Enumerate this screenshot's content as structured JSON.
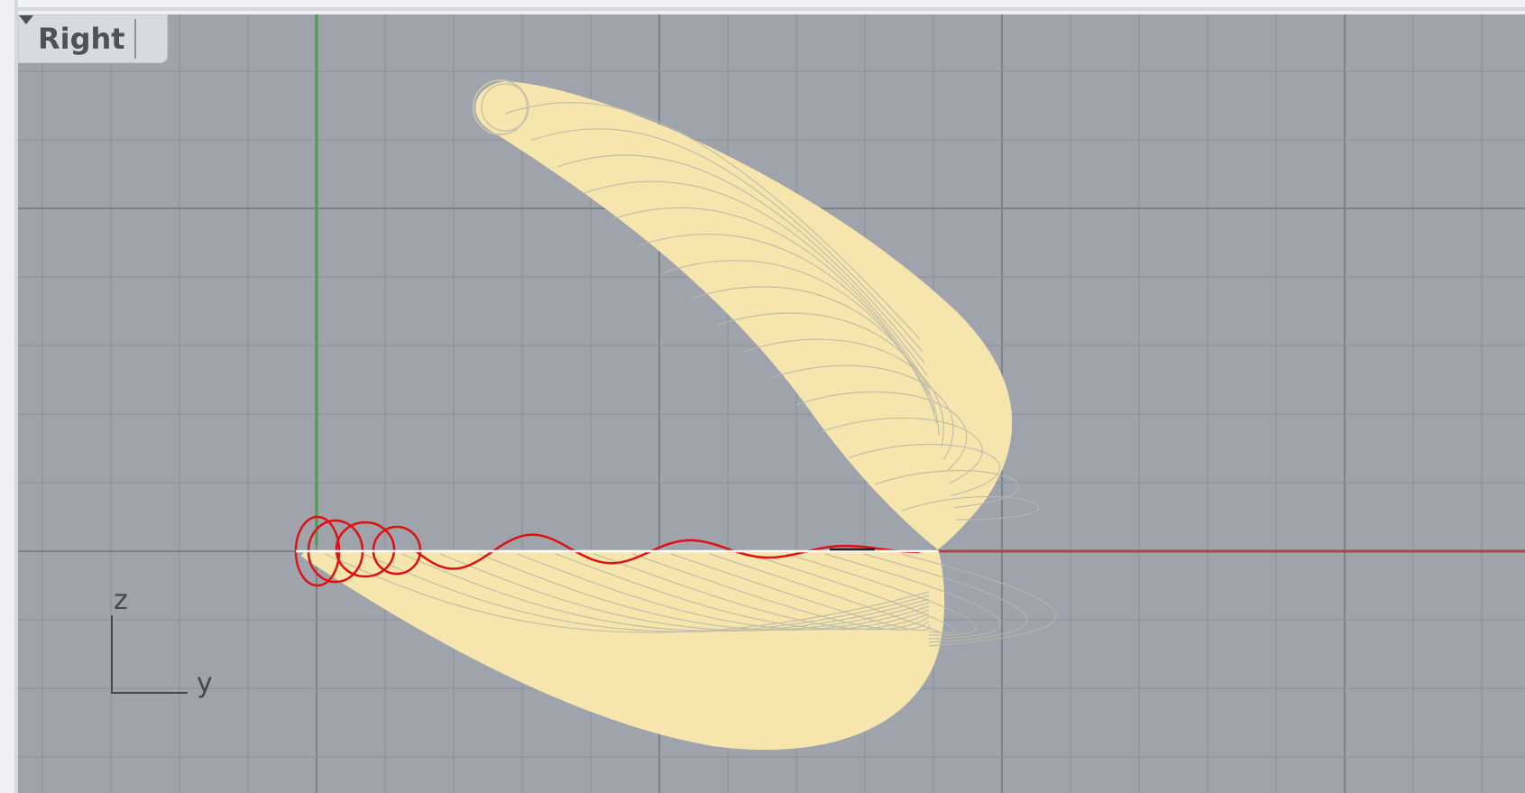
{
  "viewport": {
    "name": "Right",
    "dropdown_icon": "triangle-down-icon",
    "background": "#9ea3ac",
    "grid_minor_color": "#8e939c",
    "grid_major_color": "#7c818a",
    "axis_colors": {
      "vertical": "#4f9a4f",
      "horizontal": "#a34a45"
    }
  },
  "axis_widget": {
    "vertical_label": "z",
    "horizontal_label": "y"
  },
  "geometry": {
    "surface_color": "#f7e5ae",
    "curve_color": "#e01010",
    "edge_color": "#ffffff"
  }
}
